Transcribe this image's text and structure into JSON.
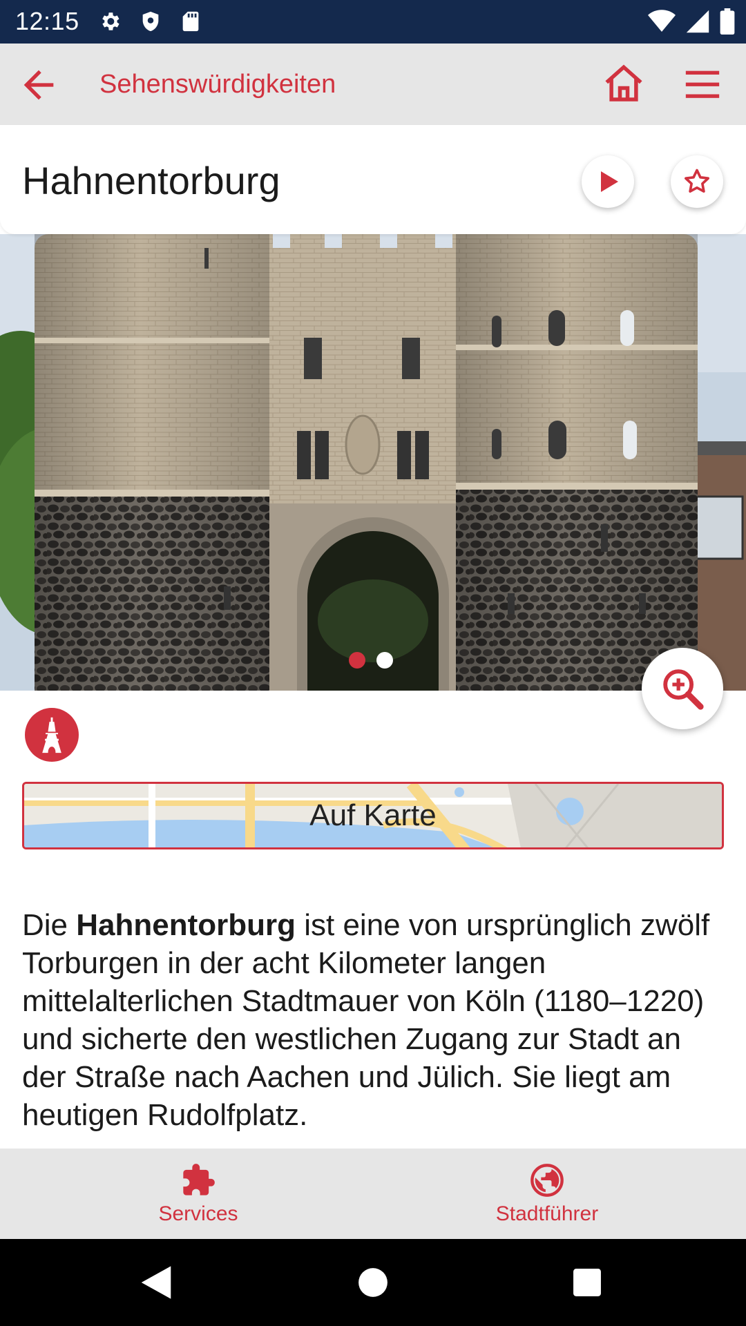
{
  "status_bar": {
    "time": "12:15",
    "icons": [
      "gear-icon",
      "shield-icon",
      "sd-card-icon",
      "wifi-icon",
      "signal-icon",
      "battery-icon"
    ]
  },
  "app_bar": {
    "title": "Sehenswürdigkeiten",
    "back_icon": "arrow-left-icon",
    "home_icon": "home-icon",
    "menu_icon": "hamburger-menu-icon"
  },
  "title_card": {
    "title": "Hahnentorburg",
    "play_icon": "play-icon",
    "favorite_icon": "star-icon"
  },
  "gallery": {
    "image": "Hahnentorburg gate photo",
    "page_count": 2,
    "active_page": 1,
    "zoom_icon": "zoom-in-icon"
  },
  "category": {
    "icon": "eiffel-tower-icon"
  },
  "map_button": {
    "label": "Auf Karte"
  },
  "description": {
    "lead": "Die ",
    "bold": "Hahnentorburg",
    "rest": " ist eine von ursprünglich zwölf Torburgen in der acht Kilometer langen mittelalterlichen Stadtmauer von Köln (1180–1220) und sicherte den westlichen Zugang zur Stadt an der Straße nach Aachen und Jülich. Sie liegt am heutigen Rudolfplatz."
  },
  "bottom_nav": {
    "items": [
      {
        "label": "Services",
        "icon": "puzzle-icon"
      },
      {
        "label": "Stadtführer",
        "icon": "globe-icon"
      }
    ]
  },
  "colors": {
    "accent": "#d1323f",
    "status_bar": "#14294d",
    "app_bar": "#e6e6e6"
  }
}
